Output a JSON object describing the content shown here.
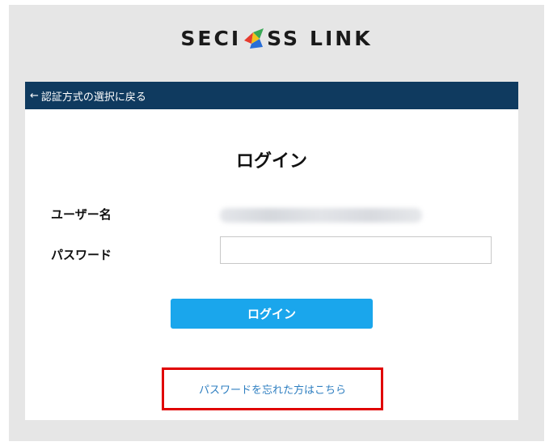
{
  "brand": {
    "part1": "SECI",
    "part2": "SS",
    "part3": "LINK",
    "colors": {
      "red": "#e63b2e",
      "green": "#3aa856",
      "blue": "#2a6fd6",
      "yellow": "#f2c31b"
    }
  },
  "nav": {
    "back_arrow": "←",
    "back_label": "認証方式の選択に戻る"
  },
  "login": {
    "title": "ログイン",
    "username_label": "ユーザー名",
    "password_label": "パスワード",
    "password_value": "",
    "submit_label": "ログイン",
    "forgot_label": "パスワードを忘れた方はこちら"
  },
  "colors": {
    "header_bar": "#0f3a5f",
    "button": "#1aa6ec",
    "link": "#2f7fc1",
    "highlight": "#e00000",
    "frame": "#e6e6e6"
  }
}
